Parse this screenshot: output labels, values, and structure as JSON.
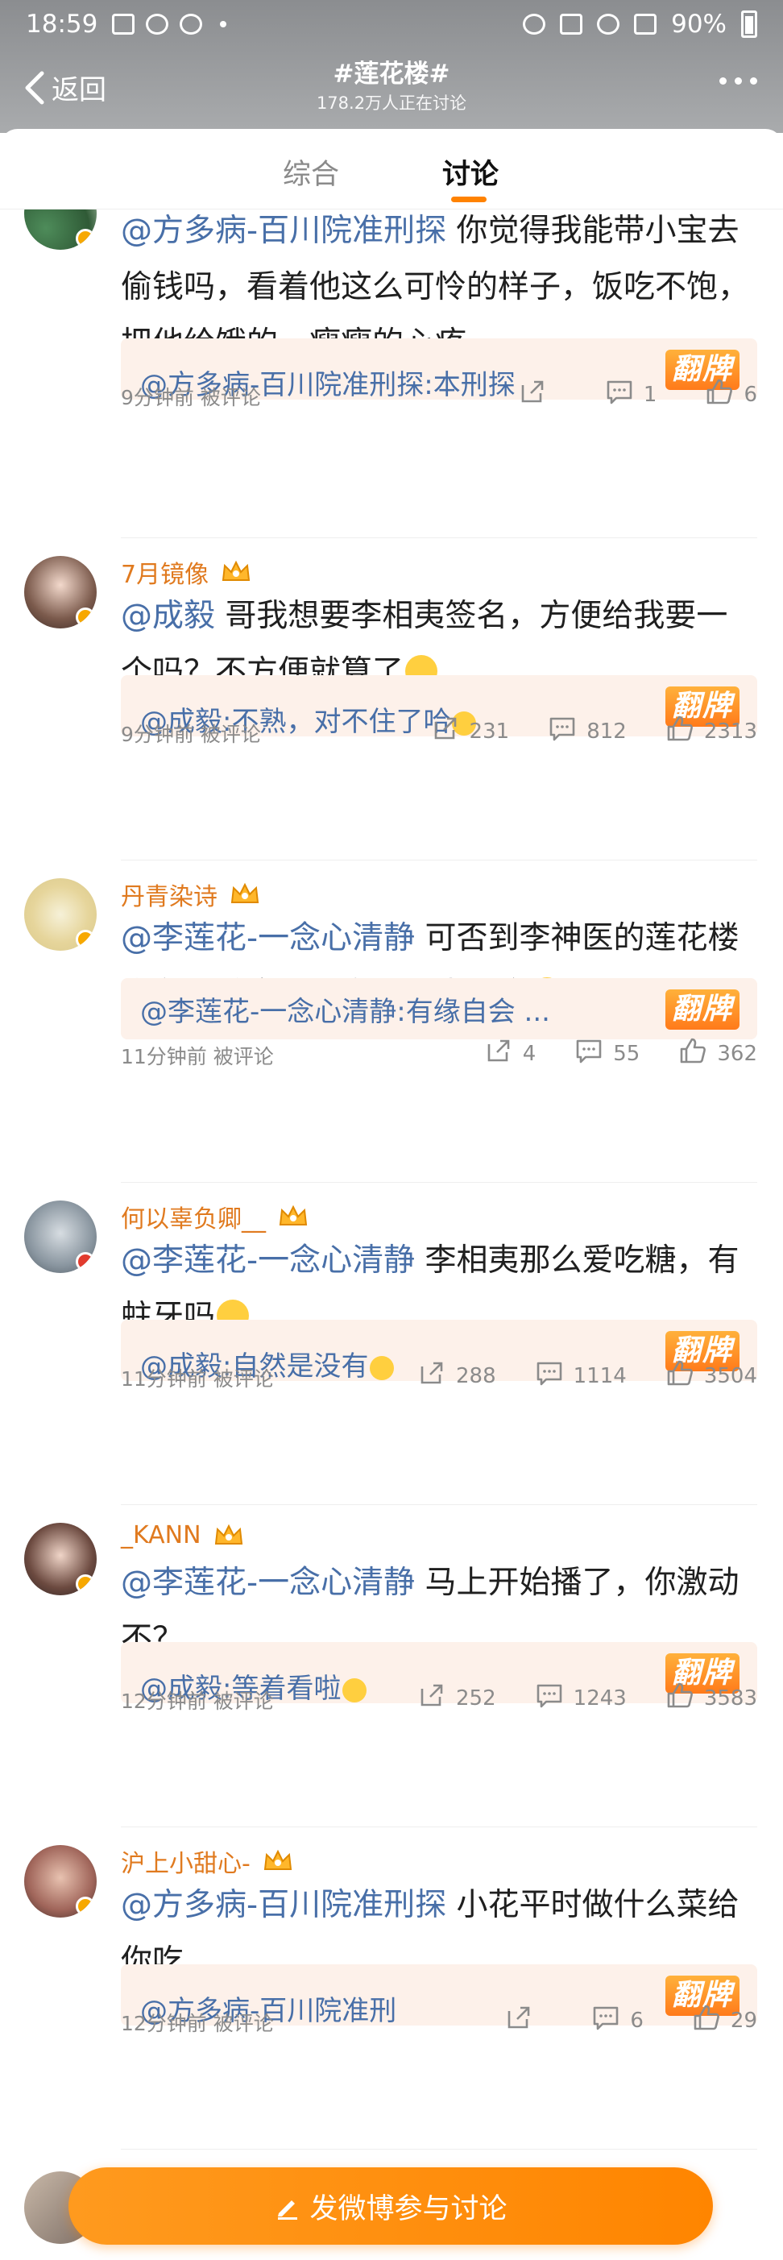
{
  "status_bar": {
    "time": "18:59",
    "battery": "90%"
  },
  "nav": {
    "back_label": "返回",
    "title": "#莲花楼#",
    "subtitle": "178.2万人正在讨论"
  },
  "tabs": [
    {
      "label": "综合"
    },
    {
      "label": "讨论"
    }
  ],
  "posts": [
    {
      "username": "",
      "mention": "@方多病-百川院准刑探",
      "body": " 你觉得我能带小宝去偷钱吗，看着他这么可怜的样子，饭吃不饱，把他给饿的，瘦瘦的心疼",
      "reply": "@方多病-百川院准刑探:本刑探",
      "reply_badge": "翻牌",
      "time": "9分钟前 被评论",
      "shares": "",
      "comments": "1",
      "likes": "6"
    },
    {
      "username": "7月镜像",
      "mention": "@成毅",
      "body": " 哥我想要李相夷签名，方便给我要一个吗？不方便就算了",
      "reply": "@成毅:不熟，对不住了哈",
      "reply_badge": "翻牌",
      "time": "9分钟前 被评论",
      "shares": "231",
      "comments": "812",
      "likes": "2313"
    },
    {
      "username": "丹青染诗",
      "mention": "@李莲花-一念心清静",
      "body": " 可否到李神医的莲花楼房车里做客？我自带酒水零食",
      "reply": "@李莲花-一念心清静:有缘自会 ...",
      "reply_badge": "翻牌",
      "time": "11分钟前 被评论",
      "shares": "4",
      "comments": "55",
      "likes": "362"
    },
    {
      "username": "何以辜负卿__",
      "mention": "@李莲花-一念心清静",
      "body": " 李相夷那么爱吃糖，有蛀牙吗",
      "reply": "@成毅:自然是没有",
      "reply_badge": "翻牌",
      "time": "11分钟前 被评论",
      "shares": "288",
      "comments": "1114",
      "likes": "3504"
    },
    {
      "username": "_KANN",
      "mention": "@李莲花-一念心清静",
      "body": " 马上开始播了，你激动不？",
      "reply": "@成毅:等着看啦",
      "reply_badge": "翻牌",
      "time": "12分钟前 被评论",
      "shares": "252",
      "comments": "1243",
      "likes": "3583"
    },
    {
      "username": "沪上小甜心-",
      "mention": "@方多病-百川院准刑探",
      "body": " 小花平时做什么菜给你吃",
      "reply": "@方多病-百川院准刑",
      "reply_badge": "翻牌",
      "time": "12分钟前 被评论",
      "shares": "",
      "comments": "6",
      "likes": "29"
    }
  ],
  "fab": {
    "label": "发微博参与讨论"
  },
  "colors": {
    "accent": "#ff8200",
    "mention": "#486fa8",
    "username": "#e07a1f",
    "reply_bg": "#fdf1ea"
  }
}
